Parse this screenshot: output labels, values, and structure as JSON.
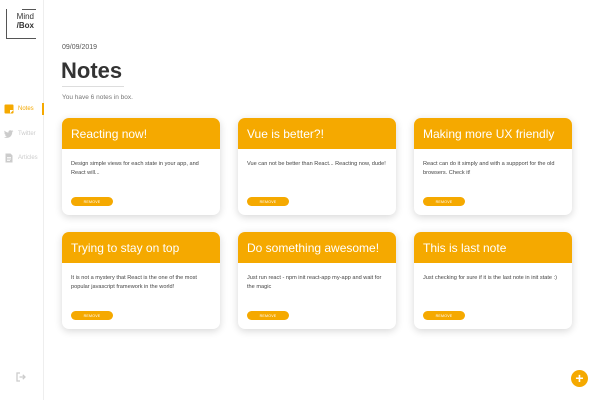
{
  "logo": {
    "line1": "Mind",
    "line2": "/Box"
  },
  "sidebar": {
    "items": [
      {
        "label": "Notes",
        "icon": "note-icon",
        "active": true
      },
      {
        "label": "Twitter",
        "icon": "twitter-icon",
        "active": false
      },
      {
        "label": "Articles",
        "icon": "article-icon",
        "active": false
      }
    ],
    "logout_icon": "logout-icon"
  },
  "header": {
    "date": "09/09/2019",
    "title": "Notes",
    "subtitle": "You have 6 notes in box."
  },
  "notes": [
    {
      "title": "Reacting now!",
      "text": "Design simple views for each state in your app, and React will...",
      "button": "REMOVE"
    },
    {
      "title": "Vue is better?!",
      "text": "Vue can not be better than React... Reacting now, dude!",
      "button": "REMOVE"
    },
    {
      "title": "Making more UX friendly",
      "text": "React can do it simply and with a suppport for the old browsers. Check it!",
      "button": "REMOVE"
    },
    {
      "title": "Trying to stay on top",
      "text": "It is not a mystery that React is the one of the most popular javascript framework in the world!",
      "button": "REMOVE"
    },
    {
      "title": "Do something awesome!",
      "text": "Just run react - npm init react-app my-app and wait for the magic",
      "button": "REMOVE"
    },
    {
      "title": "This is last note",
      "text": "Just checking for sure if it is the last note in init state :)",
      "button": "REMOVE"
    }
  ],
  "fab": {
    "label": "+"
  },
  "colors": {
    "accent": "#f5a900",
    "muted": "#cccccc"
  }
}
